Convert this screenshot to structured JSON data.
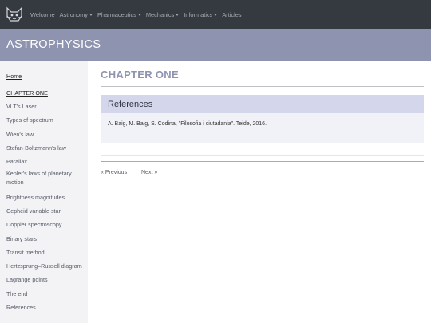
{
  "navbar": {
    "items": [
      {
        "label": "Welcome",
        "dropdown": false
      },
      {
        "label": "Astronomy",
        "dropdown": true
      },
      {
        "label": "Pharmaceutics",
        "dropdown": true
      },
      {
        "label": "Mechanics",
        "dropdown": true
      },
      {
        "label": "Informatics",
        "dropdown": true
      },
      {
        "label": "Articles",
        "dropdown": false
      }
    ]
  },
  "banner": {
    "title": "ASTROPHYSICS"
  },
  "sidebar": {
    "items": [
      {
        "label": "Home"
      },
      {
        "label": "CHAPTER ONE"
      },
      {
        "label": "VLT's Laser"
      },
      {
        "label": "Types of spectrum"
      },
      {
        "label": "Wien's law"
      },
      {
        "label": "Stefan-Boltzmann's law"
      },
      {
        "label": "Parallax"
      },
      {
        "label": "Kepler's laws of planetary motion"
      },
      {
        "label": "Brightness magnitudes"
      },
      {
        "label": "Cepheid variable star"
      },
      {
        "label": "Doppler spectroscopy"
      },
      {
        "label": "Binary stars"
      },
      {
        "label": "Transit method"
      },
      {
        "label": "Hertzsprung–Russell diagram"
      },
      {
        "label": "Lagrange points"
      },
      {
        "label": "The end"
      },
      {
        "label": "References"
      }
    ]
  },
  "main": {
    "chapter_title": "CHAPTER ONE",
    "references": {
      "title": "References",
      "body": "A. Baig, M. Baig, S. Codina, \"Filosofia i ciutadania\". Teide, 2016."
    },
    "pager": {
      "previous": "« Previous",
      "next": "Next »"
    }
  }
}
